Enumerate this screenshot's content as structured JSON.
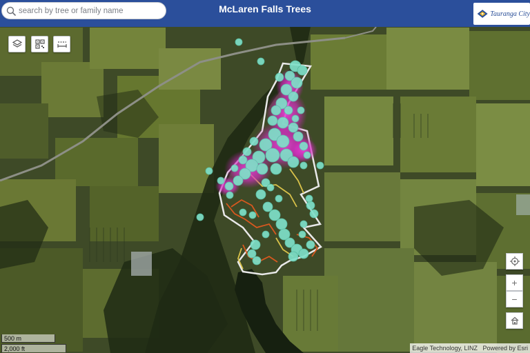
{
  "header": {
    "title": "McLaren Falls Trees",
    "search_placeholder": "search by tree or family name",
    "logo_text": "Tauranga City"
  },
  "toolbar": {
    "buttons": [
      "layers-icon",
      "qr-code-icon",
      "measure-icon"
    ]
  },
  "navigation": {
    "zoom_in_label": "+",
    "zoom_out_label": "−",
    "buttons": [
      "locate-icon",
      "zoom-in-button",
      "zoom-out-button",
      "home-icon"
    ]
  },
  "scalebar": {
    "metric_label": "500 m",
    "imperial_label": "2,000 ft"
  },
  "attribution": {
    "text": "Eagle Technology, LINZ",
    "powered_by": "Powered by Esri"
  },
  "colors": {
    "header_bg": "#2b4f9b",
    "tree_point": "#7fe0c9",
    "heatmap": "#e83fd7",
    "park_boundary": "#e9e9e9",
    "trail_orange": "#d8581f",
    "trail_yellow": "#d9c24a"
  }
}
